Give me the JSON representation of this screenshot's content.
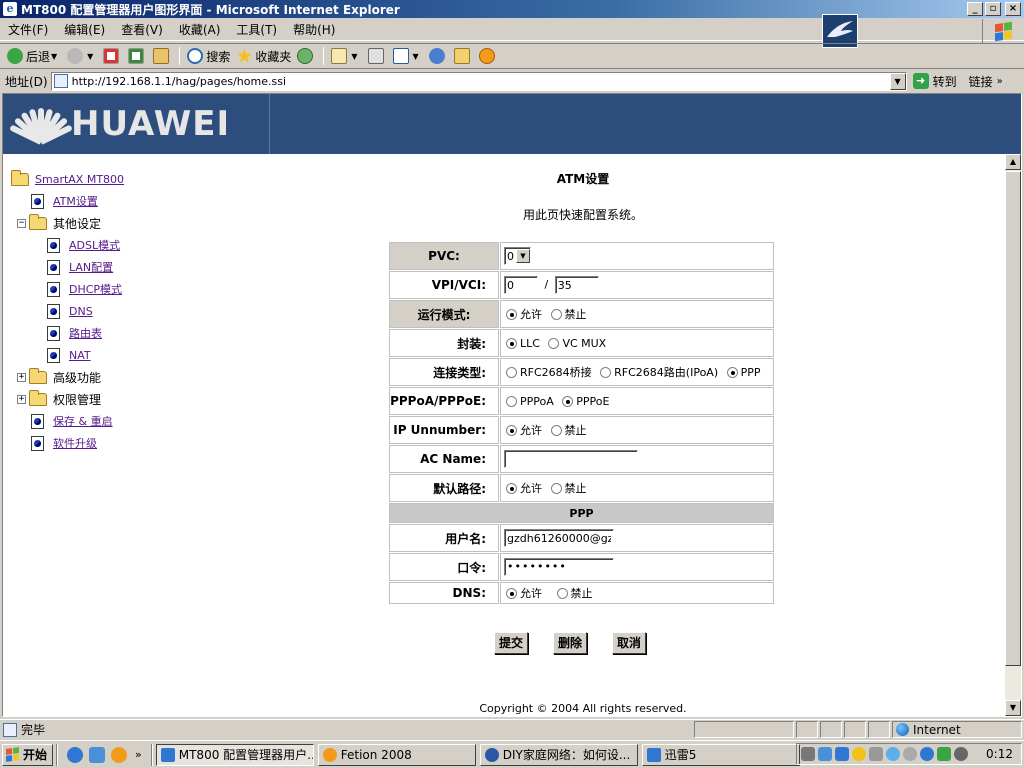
{
  "window": {
    "title": "MT800 配置管理器用户图形界面 - Microsoft Internet Explorer",
    "controls": {
      "minimize": "_",
      "maximize": "▫",
      "close": "×"
    }
  },
  "menu": [
    "文件(F)",
    "编辑(E)",
    "查看(V)",
    "收藏(A)",
    "工具(T)",
    "帮助(H)"
  ],
  "toolbar": {
    "back": "后退",
    "search": "搜索",
    "favorites": "收藏夹"
  },
  "address": {
    "label": "地址(D)",
    "url": "http://192.168.1.1/hag/pages/home.ssi",
    "go": "转到",
    "links": "链接"
  },
  "brand": {
    "logo_text": "HUAWEI"
  },
  "nav": {
    "root": "SmartAX MT800",
    "atm": "ATM设置",
    "other": "其他设定",
    "other_items": [
      "ADSL模式",
      "LAN配置",
      "DHCP模式",
      "DNS",
      "路由表",
      "NAT"
    ],
    "advanced": "高级功能",
    "permissions": "权限管理",
    "save_restart": "保存 & 重启",
    "upgrade": "软件升级"
  },
  "page": {
    "title": "ATM设置",
    "description": "用此页快速配置系统。",
    "copyright": "Copyright © 2004 All rights reserved."
  },
  "form": {
    "pvc_label": "PVC:",
    "pvc_value": "0",
    "vpivci_label": "VPI/VCI:",
    "vpi": "0",
    "vci": "35",
    "slash": "/",
    "run_mode_label": "运行模式:",
    "allow": "允许",
    "deny": "禁止",
    "encap_label": "封装:",
    "llc": "LLC",
    "vcmux": "VC MUX",
    "conn_type_label": "连接类型:",
    "ct_bridge": "RFC2684桥接",
    "ct_route": "RFC2684路由(IPoA)",
    "ct_ppp": "PPP",
    "pppoa_label": "PPPoA/PPPoE:",
    "pppoa": "PPPoA",
    "pppoe": "PPPoE",
    "ip_unnumber_label": "IP Unnumber:",
    "ac_name_label": "AC Name:",
    "ac_name_value": "",
    "default_route_label": "默认路径:",
    "ppp_header": "PPP",
    "username_label": "用户名:",
    "username_value": "gzdh61260000@gz",
    "password_label": "口令:",
    "password_value": "••••••••",
    "dns_label": "DNS:"
  },
  "buttons": {
    "submit": "提交",
    "delete": "删除",
    "cancel": "取消"
  },
  "status": {
    "text": "完毕",
    "zone": "Internet"
  },
  "taskbar": {
    "start": "开始",
    "chevron": "»",
    "tasks": [
      "MT800 配置管理器用户...",
      "Fetion 2008",
      "DIY家庭网络：如何设...",
      "迅雷5"
    ],
    "clock": "0:12"
  },
  "colors": {
    "banner": "#2e4e7d",
    "titlebar_start": "#0a246a",
    "link": "#551a8b"
  }
}
